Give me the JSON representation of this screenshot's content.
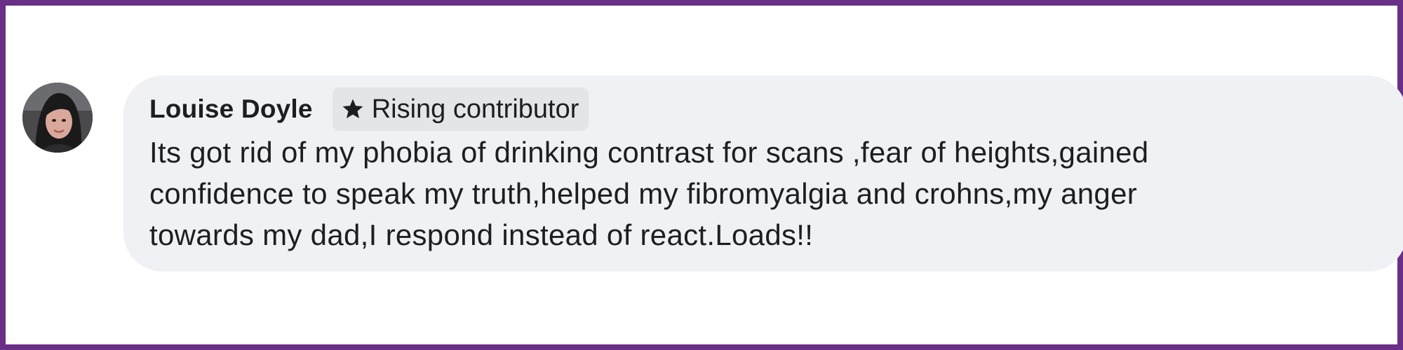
{
  "comment": {
    "author": "Louise Doyle",
    "badge": {
      "icon": "star-icon",
      "label": "Rising contributor"
    },
    "text": "Its got rid of my phobia of drinking contrast for scans ,fear of heights,gained\nconfidence to speak my truth,helped my fibromyalgia and crohns,my anger\ntowards my dad,I respond instead of react.Loads!!"
  },
  "colors": {
    "frame_border": "#6a2f87",
    "bubble_background": "#f0f1f4",
    "badge_background": "#e3e5e9",
    "text": "#1c1e21"
  }
}
